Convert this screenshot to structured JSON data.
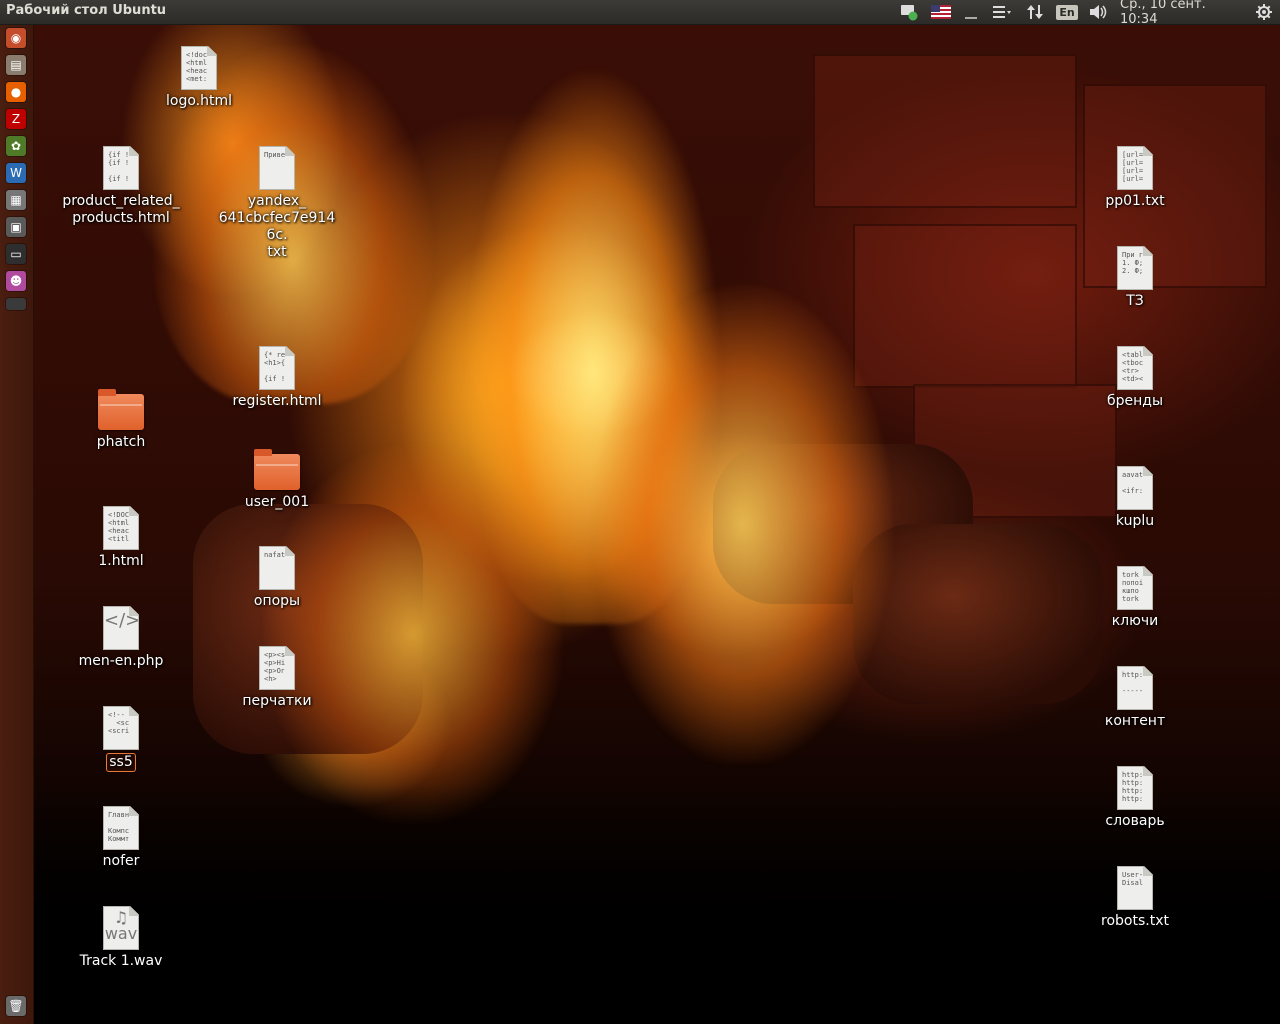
{
  "panel": {
    "title": "Рабочий стол Ubuntu",
    "lang_badge": "En",
    "clock": "Ср., 10 сент. 10:34",
    "tray_icons": [
      "network-icon",
      "us-flag-icon",
      "indicator-icon",
      "menu-icon",
      "transfer-icon",
      "keyboard-layout-icon",
      "volume-icon",
      "gear-icon"
    ]
  },
  "launcher": {
    "items": [
      "dash-home-icon",
      "file-manager-icon",
      "firefox-icon",
      "filezilla-icon",
      "gimp-icon",
      "libreoffice-writer-icon",
      "calculator-icon",
      "system-monitor-icon",
      "terminal-icon",
      "app-icon",
      "workspace-icon",
      "trash-icon"
    ]
  },
  "desktop": {
    "icons": [
      {
        "label": "logo.html",
        "type": "file",
        "preview": "<!doc\n<html\n<heac\n<met:"
      },
      {
        "label": "product_related_\nproducts.html",
        "type": "file",
        "preview": "{if !\n{if !\n\n{if !"
      },
      {
        "label": "yandex_\n641cbcfec7e9146c.\ntxt",
        "type": "file",
        "preview": "Приве"
      },
      {
        "label": "register.html",
        "type": "file",
        "preview": "{* re\n<h1>{\n\n{if !"
      },
      {
        "label": "phatch",
        "type": "folder"
      },
      {
        "label": "user_001",
        "type": "folder"
      },
      {
        "label": "1.html",
        "type": "file",
        "preview": "<!DOC\n<html\n<heac\n<titl"
      },
      {
        "label": "опоры",
        "type": "file",
        "preview": "nafat"
      },
      {
        "label": "men-en.php",
        "type": "code",
        "preview": "</>"
      },
      {
        "label": "перчатки",
        "type": "file",
        "preview": "<p><s\n<p>Ні\n<p>Ог\n<h>"
      },
      {
        "label": "ss5",
        "type": "file",
        "preview": "<!--\n  <sc\n<scri"
      },
      {
        "label": "nofer",
        "type": "file",
        "preview": "Главн\n\nКомпс\nКоммт"
      },
      {
        "label": "Track 1.wav",
        "type": "audio",
        "preview": "♫\nwav"
      },
      {
        "label": "pp01.txt",
        "type": "file",
        "preview": "[url=\n[url=\n[url=\n[url="
      },
      {
        "label": "ТЗ",
        "type": "file",
        "preview": "При г\n1. Ф;\n2. Ф;"
      },
      {
        "label": "бренды",
        "type": "file",
        "preview": "<tabl\n<tboc\n<tr>\n<td><"
      },
      {
        "label": "kuplu",
        "type": "file",
        "preview": "aavat\n\n<ifr:"
      },
      {
        "label": "ключи",
        "type": "file",
        "preview": "tork\nпопоі\nкшпо\ntork"
      },
      {
        "label": "контент",
        "type": "file",
        "preview": "http:\n\n-----"
      },
      {
        "label": "словарь",
        "type": "file",
        "preview": "http:\nhttp:\nhttp:\nhttp:"
      },
      {
        "label": "robots.txt",
        "type": "file",
        "preview": "User-\nDisal"
      }
    ]
  }
}
